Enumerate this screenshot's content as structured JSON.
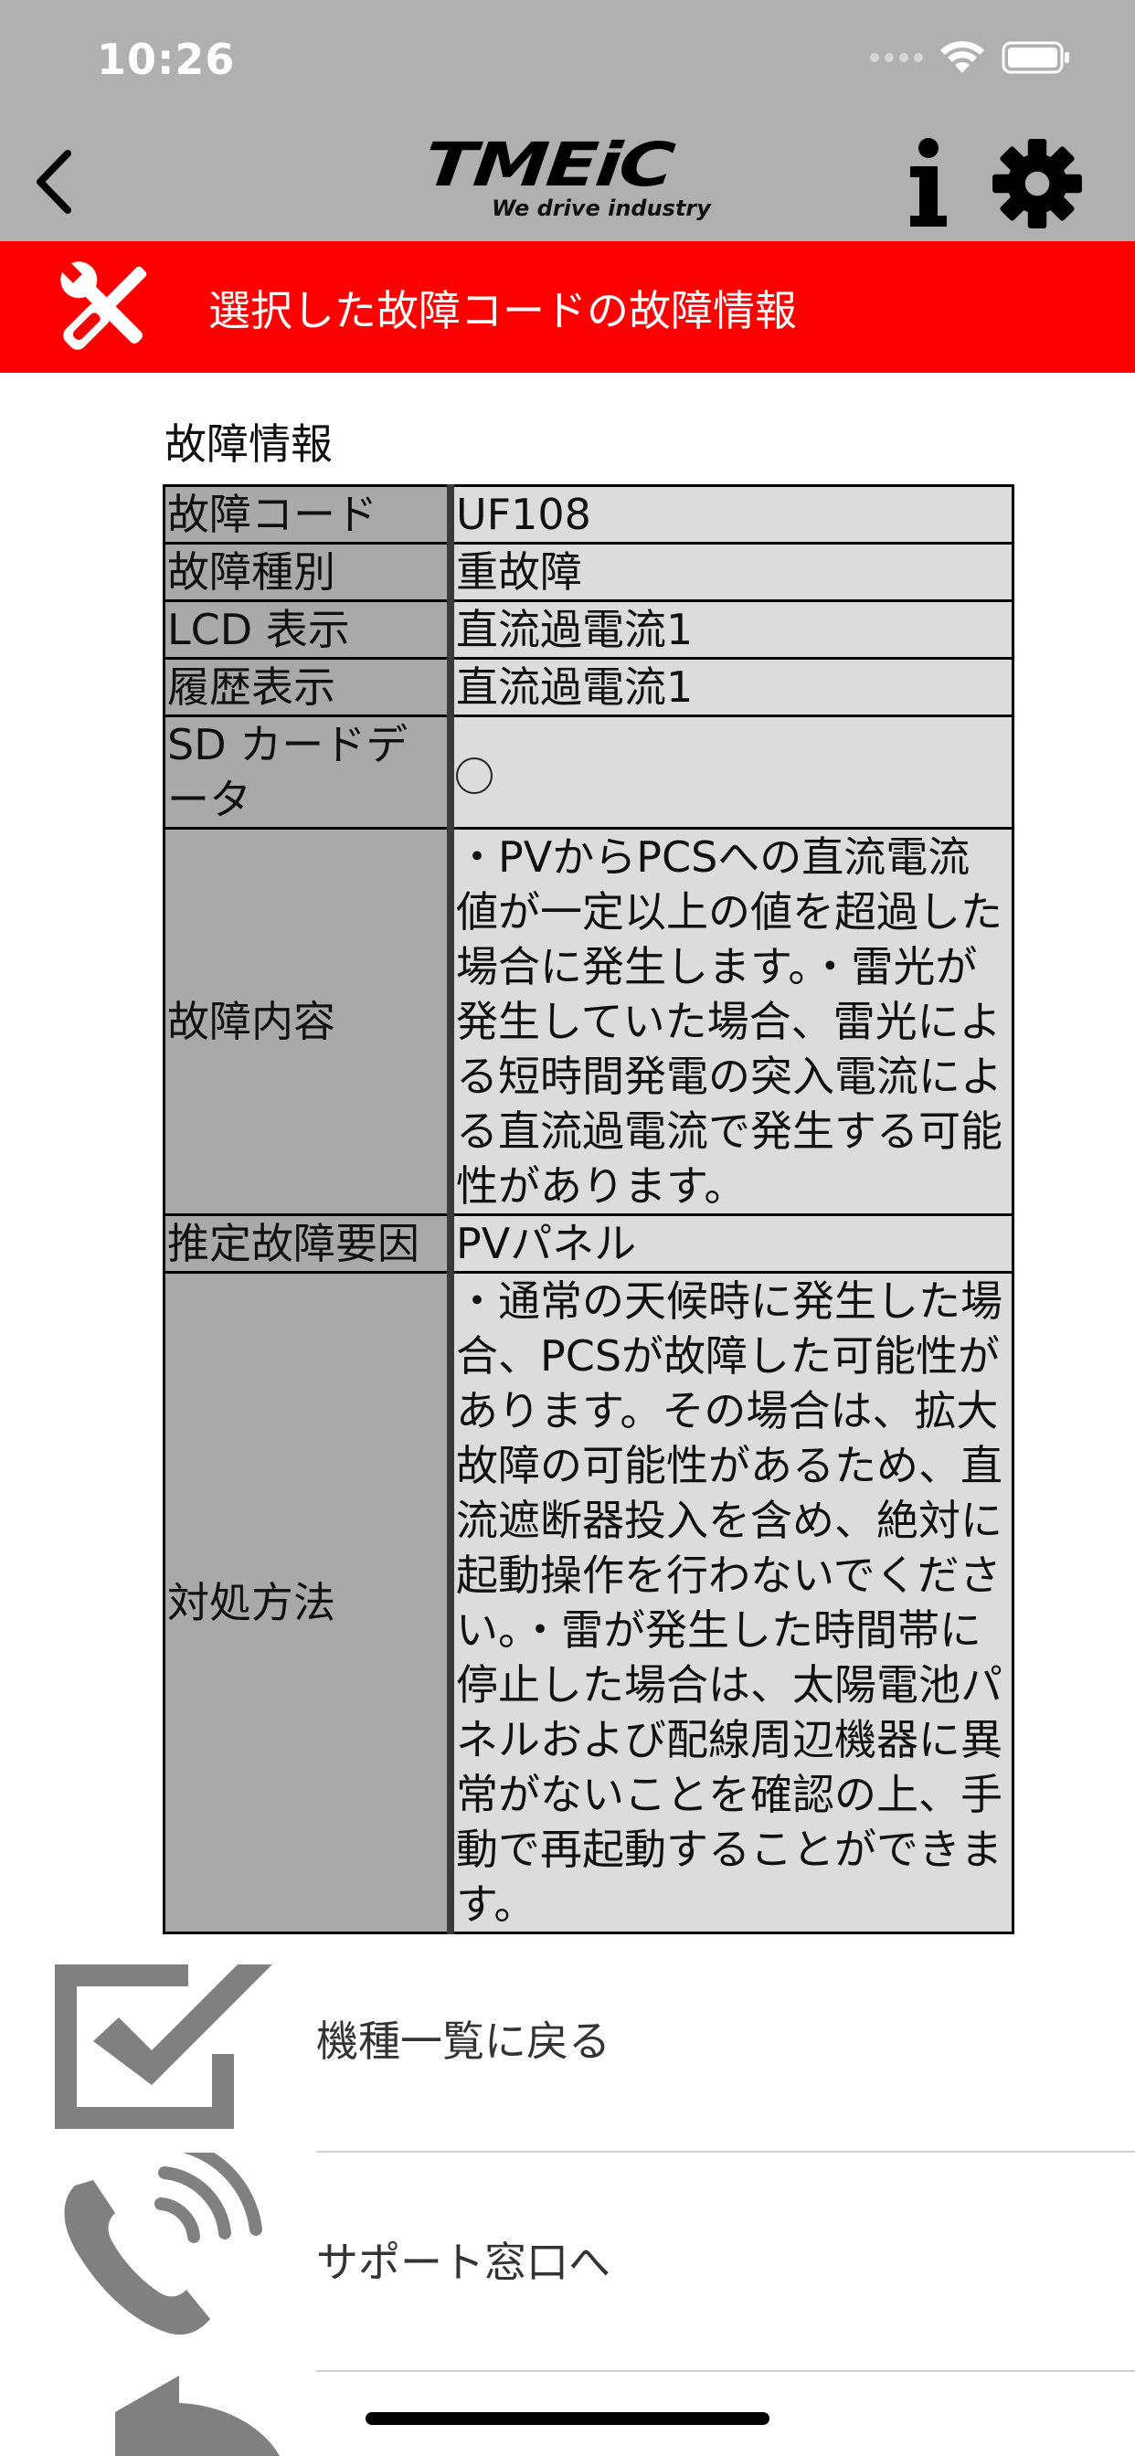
{
  "status_bar": {
    "time": "10:26"
  },
  "nav": {
    "logo_text": "TMEiC",
    "logo_tagline": "We drive industry",
    "back_icon": "chevron-left-icon",
    "info_icon": "info-icon",
    "settings_icon": "gear-icon"
  },
  "banner": {
    "title": "選択した故障コードの故障情報",
    "icon": "tools-icon",
    "color": "#ff0000"
  },
  "section": {
    "label": "故障情報"
  },
  "fault_table": {
    "rows": [
      {
        "key": "故障コード",
        "value": "UF108"
      },
      {
        "key": "故障種別",
        "value": "重故障"
      },
      {
        "key": "LCD 表示",
        "value": "直流過電流1"
      },
      {
        "key": "履歴表示",
        "value": "直流過電流1"
      },
      {
        "key": "SD カードデータ",
        "value": "◯"
      },
      {
        "key": "故障内容",
        "value": "・PVからPCSへの直流電流値が一定以上の値を超過した場合に発生します。・雷光が発生していた場合、雷光による短時間発電の突入電流による直流過電流で発生する可能性があります。"
      },
      {
        "key": "推定故障要因",
        "value": "PVパネル"
      },
      {
        "key": "対処方法",
        "value": "・通常の天候時に発生した場合、PCSが故障した可能性があります。その場合は、拡大故障の可能性があるため、直流遮断器投入を含め、絶対に起動操作を行わないでください。・雷が発生した時間帯に停止した場合は、太陽電池パネルおよび配線周辺機器に異常がないことを確認の上、手動で再起動することができます。"
      }
    ]
  },
  "menu": {
    "items": [
      {
        "label": "機種一覧に戻る",
        "icon": "checkbox-icon"
      },
      {
        "label": "サポート窓口へ",
        "icon": "phone-icon"
      },
      {
        "label": "",
        "icon": "return-arrow-icon"
      }
    ]
  },
  "colors": {
    "header_bg": "#b0b0b0",
    "key_cell_bg": "#a9a9a9",
    "value_cell_bg": "#dcdcdc",
    "menu_icon_gray": "#808080"
  }
}
